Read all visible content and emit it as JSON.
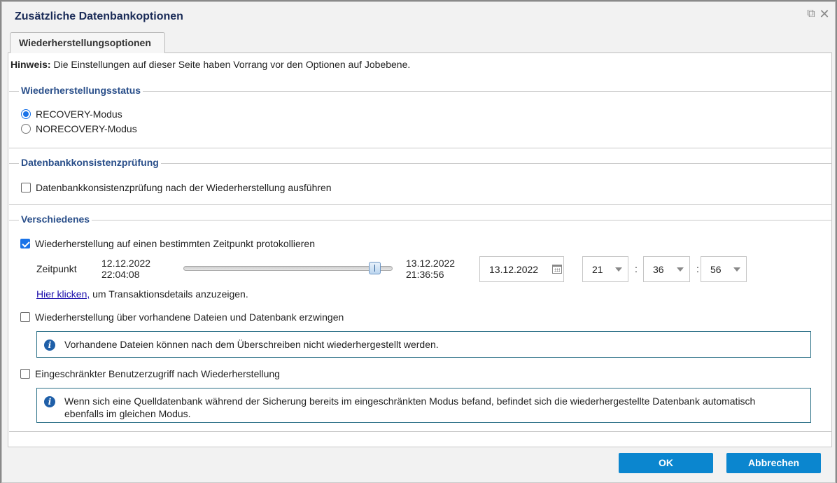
{
  "dialog": {
    "title": "Zusätzliche Datenbankoptionen",
    "tab_label": "Wiederherstellungsoptionen"
  },
  "note": {
    "label": "Hinweis:",
    "text": " Die Einstellungen auf dieser Seite haben Vorrang vor den Optionen auf Jobebene."
  },
  "recovery_status": {
    "legend": "Wiederherstellungsstatus",
    "options": [
      {
        "label": "RECOVERY-Modus",
        "selected": true
      },
      {
        "label": "NORECOVERY-Modus",
        "selected": false
      }
    ]
  },
  "consistency": {
    "legend": "Datenbankkonsistenzprüfung",
    "checkbox_label": "Datenbankkonsistenzprüfung nach der Wiederherstellung ausführen",
    "checked": false
  },
  "misc": {
    "legend": "Verschiedenes",
    "point_in_time": {
      "label": "Wiederherstellung auf einen bestimmten Zeitpunkt protokollieren",
      "checked": true
    },
    "zeitpunkt": {
      "label": "Zeitpunkt",
      "range_start_date": "12.12.2022",
      "range_start_time": "22:04:08",
      "range_end_date": "13.12.2022",
      "range_end_time": "21:36:56",
      "slider_position": 0.92,
      "date_value": "13.12.2022",
      "hour": "21",
      "minute": "36",
      "second": "56",
      "separator": ":"
    },
    "details_link": "Hier klicken,",
    "details_text": " um Transaktionsdetails anzuzeigen.",
    "force_restore": {
      "label": "Wiederherstellung über vorhandene Dateien und Datenbank erzwingen",
      "checked": false,
      "info": "Vorhandene Dateien können nach dem Überschreiben nicht wiederhergestellt werden."
    },
    "restricted_access": {
      "label": "Eingeschränkter Benutzerzugriff nach Wiederherstellung",
      "checked": false,
      "info": "Wenn sich eine Quelldatenbank während der Sicherung bereits im eingeschränkten Modus befand, befindet sich die wiederhergestellte Datenbank automatisch ebenfalls im gleichen Modus."
    }
  },
  "buttons": {
    "ok": "OK",
    "cancel": "Abbrechen"
  },
  "colors": {
    "accent": "#1a73e8",
    "button": "#0b86cf",
    "legend": "#2a4f8a",
    "title": "#1a2b57"
  }
}
